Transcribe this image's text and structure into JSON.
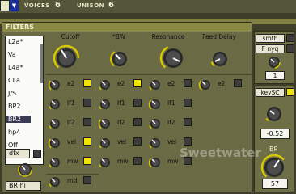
{
  "topbar": {
    "voices_label": "VOICES",
    "voices_value": "6",
    "unison_label": "UNISON",
    "unison_value": "6"
  },
  "filters": {
    "title": "FILTERS",
    "types": [
      "L2a*",
      "Va",
      "L4a*",
      "CLa",
      "J/S",
      "BP2",
      "BR2",
      "hp4",
      "Off"
    ],
    "selected_type": "BR2",
    "button_a": "dfx",
    "button_b": "BR hi",
    "columns": [
      "Cutoff",
      "*BW",
      "Resonance",
      "Feed Delay"
    ],
    "mod_rows": [
      [
        "e2",
        "e2",
        "e2",
        "e2"
      ],
      [
        "lf1",
        "lf1",
        "lf1",
        ""
      ],
      [
        "lf2",
        "lf2",
        "lf2",
        ""
      ],
      [
        "vel",
        "vel",
        "vel",
        ""
      ],
      [
        "mw",
        "mw",
        "mw",
        ""
      ],
      [
        "rnd",
        "",
        "",
        ""
      ]
    ]
  },
  "right": {
    "smth": "smth",
    "f_nyq": "F nyq",
    "value1": "1",
    "keysc": "keySC",
    "value2": "-0.52",
    "bp_label": "BP",
    "value3": "57"
  },
  "watermark": "Sweetwater",
  "colors": {
    "led_on": "#f2e400",
    "knob_ring": "#d8c800",
    "panel": "#6a6a45"
  }
}
